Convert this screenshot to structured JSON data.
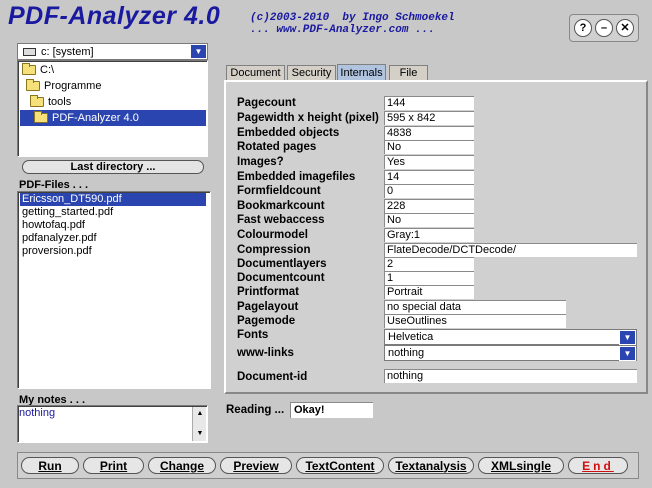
{
  "header": {
    "title": "PDF-Analyzer 4.0",
    "copyright": "(c)2003-2010  by Ingo Schmoekel",
    "url": "... www.PDF-Analyzer.com ..."
  },
  "window_buttons": {
    "help": "?",
    "minimize": "–",
    "close": "✕"
  },
  "drive": {
    "value": "c: [system]",
    "arrow": "▼"
  },
  "folders": [
    {
      "label": "C:\\",
      "selected": false
    },
    {
      "label": "Programme",
      "selected": false
    },
    {
      "label": "tools",
      "selected": false
    },
    {
      "label": "PDF-Analyzer 4.0",
      "selected": true
    }
  ],
  "last_directory_label": "Last directory ...",
  "pdf_files": {
    "label": "PDF-Files . . .",
    "items": [
      {
        "name": "Ericsson_DT590.pdf",
        "selected": true
      },
      {
        "name": "getting_started.pdf",
        "selected": false
      },
      {
        "name": "howtofaq.pdf",
        "selected": false
      },
      {
        "name": "pdfanalyzer.pdf",
        "selected": false
      },
      {
        "name": "proversion.pdf",
        "selected": false
      }
    ]
  },
  "notes": {
    "label": "My notes . . .",
    "text": "nothing",
    "up": "▲",
    "down": "▼"
  },
  "tabs": [
    {
      "label": "Document",
      "active": false
    },
    {
      "label": "Security",
      "active": false
    },
    {
      "label": "Internals",
      "active": true
    },
    {
      "label": "File",
      "active": false
    }
  ],
  "properties": {
    "pagecount": {
      "label": "Pagecount",
      "value": "144"
    },
    "pagesize": {
      "label": "Pagewidth x height (pixel)",
      "value": "595 x 842"
    },
    "embedded_objects": {
      "label": "Embedded objects",
      "value": "4838"
    },
    "rotated_pages": {
      "label": "Rotated pages",
      "value": "No"
    },
    "images": {
      "label": "Images?",
      "value": "Yes"
    },
    "embedded_imagefiles": {
      "label": "Embedded imagefiles",
      "value": "14"
    },
    "formfieldcount": {
      "label": "Formfieldcount",
      "value": "0"
    },
    "bookmarkcount": {
      "label": "Bookmarkcount",
      "value": "228"
    },
    "fast_webaccess": {
      "label": "Fast webaccess",
      "value": "No"
    },
    "colourmodel": {
      "label": "Colourmodel",
      "value": "Gray:1"
    },
    "compression": {
      "label": "Compression",
      "value": "FlateDecode/DCTDecode/"
    },
    "documentlayers": {
      "label": "Documentlayers",
      "value": "2"
    },
    "documentcount": {
      "label": "Documentcount",
      "value": "1"
    },
    "printformat": {
      "label": "Printformat",
      "value": "Portrait"
    },
    "pagelayout": {
      "label": "Pagelayout",
      "value": "no special data"
    },
    "pagemode": {
      "label": "Pagemode",
      "value": "UseOutlines"
    },
    "fonts": {
      "label": "Fonts",
      "value": "Helvetica"
    },
    "www_links": {
      "label": "www-links",
      "value": "nothing"
    },
    "document_id": {
      "label": "Document-id",
      "value": "nothing"
    }
  },
  "status": {
    "label": "Reading ...",
    "value": "Okay!"
  },
  "buttons": {
    "run": "Run",
    "print": "Print",
    "change": "Change",
    "preview": "Preview",
    "textcontent": "TextContent",
    "textanalysis": "Textanalysis",
    "xmlsingle": "XMLsingle",
    "end": "End"
  }
}
